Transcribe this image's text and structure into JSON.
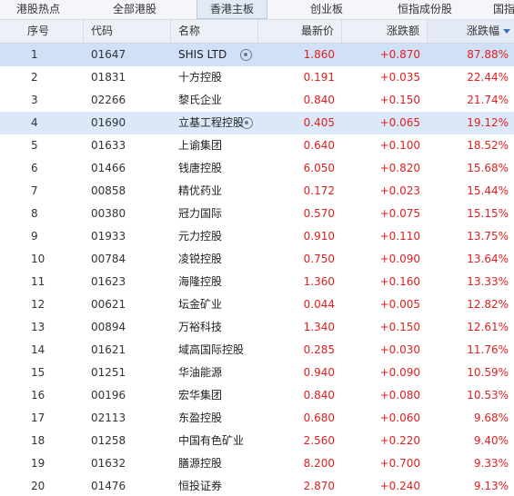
{
  "tabs": [
    "港股热点",
    "全部港股",
    "香港主板",
    "创业板",
    "恒指成份股",
    "国指"
  ],
  "active_tab": "香港主板",
  "columns": {
    "idx": "序号",
    "code": "代码",
    "name": "名称",
    "price": "最新价",
    "change": "涨跌额",
    "pct": "涨跌幅"
  },
  "sorted_column": "pct",
  "sort_direction": "desc",
  "colors": {
    "up": "#e02020",
    "selected_row": "#cfe0f7",
    "header_bg": "#edf1f7"
  },
  "rows": [
    {
      "idx": "1",
      "code": "01647",
      "name": "SHIS LTD",
      "price": "1.860",
      "change": "+0.870",
      "pct": "87.88%",
      "watch_icon": true,
      "selected": true
    },
    {
      "idx": "2",
      "code": "01831",
      "name": "十方控股",
      "price": "0.191",
      "change": "+0.035",
      "pct": "22.44%"
    },
    {
      "idx": "3",
      "code": "02266",
      "name": "黎氏企业",
      "price": "0.840",
      "change": "+0.150",
      "pct": "21.74%"
    },
    {
      "idx": "4",
      "code": "01690",
      "name": "立基工程控股",
      "price": "0.405",
      "change": "+0.065",
      "pct": "19.12%",
      "watch_icon": true,
      "hover": true
    },
    {
      "idx": "5",
      "code": "01633",
      "name": "上谕集团",
      "price": "0.640",
      "change": "+0.100",
      "pct": "18.52%"
    },
    {
      "idx": "6",
      "code": "01466",
      "name": "钱唐控股",
      "price": "6.050",
      "change": "+0.820",
      "pct": "15.68%"
    },
    {
      "idx": "7",
      "code": "00858",
      "name": "精优药业",
      "price": "0.172",
      "change": "+0.023",
      "pct": "15.44%"
    },
    {
      "idx": "8",
      "code": "00380",
      "name": "冠力国际",
      "price": "0.570",
      "change": "+0.075",
      "pct": "15.15%"
    },
    {
      "idx": "9",
      "code": "01933",
      "name": "元力控股",
      "price": "0.910",
      "change": "+0.110",
      "pct": "13.75%"
    },
    {
      "idx": "10",
      "code": "00784",
      "name": "凌锐控股",
      "price": "0.750",
      "change": "+0.090",
      "pct": "13.64%"
    },
    {
      "idx": "11",
      "code": "01623",
      "name": "海隆控股",
      "price": "1.360",
      "change": "+0.160",
      "pct": "13.33%"
    },
    {
      "idx": "12",
      "code": "00621",
      "name": "坛金矿业",
      "price": "0.044",
      "change": "+0.005",
      "pct": "12.82%"
    },
    {
      "idx": "13",
      "code": "00894",
      "name": "万裕科技",
      "price": "1.340",
      "change": "+0.150",
      "pct": "12.61%"
    },
    {
      "idx": "14",
      "code": "01621",
      "name": "域高国际控股",
      "price": "0.285",
      "change": "+0.030",
      "pct": "11.76%"
    },
    {
      "idx": "15",
      "code": "01251",
      "name": "华油能源",
      "price": "0.940",
      "change": "+0.090",
      "pct": "10.59%"
    },
    {
      "idx": "16",
      "code": "00196",
      "name": "宏华集团",
      "price": "0.840",
      "change": "+0.080",
      "pct": "10.53%"
    },
    {
      "idx": "17",
      "code": "02113",
      "name": "东盈控股",
      "price": "0.680",
      "change": "+0.060",
      "pct": "9.68%"
    },
    {
      "idx": "18",
      "code": "01258",
      "name": "中国有色矿业",
      "price": "2.560",
      "change": "+0.220",
      "pct": "9.40%"
    },
    {
      "idx": "19",
      "code": "01632",
      "name": "膳源控股",
      "price": "8.200",
      "change": "+0.700",
      "pct": "9.33%"
    },
    {
      "idx": "20",
      "code": "01476",
      "name": "恒投证券",
      "price": "2.870",
      "change": "+0.240",
      "pct": "9.13%"
    }
  ]
}
